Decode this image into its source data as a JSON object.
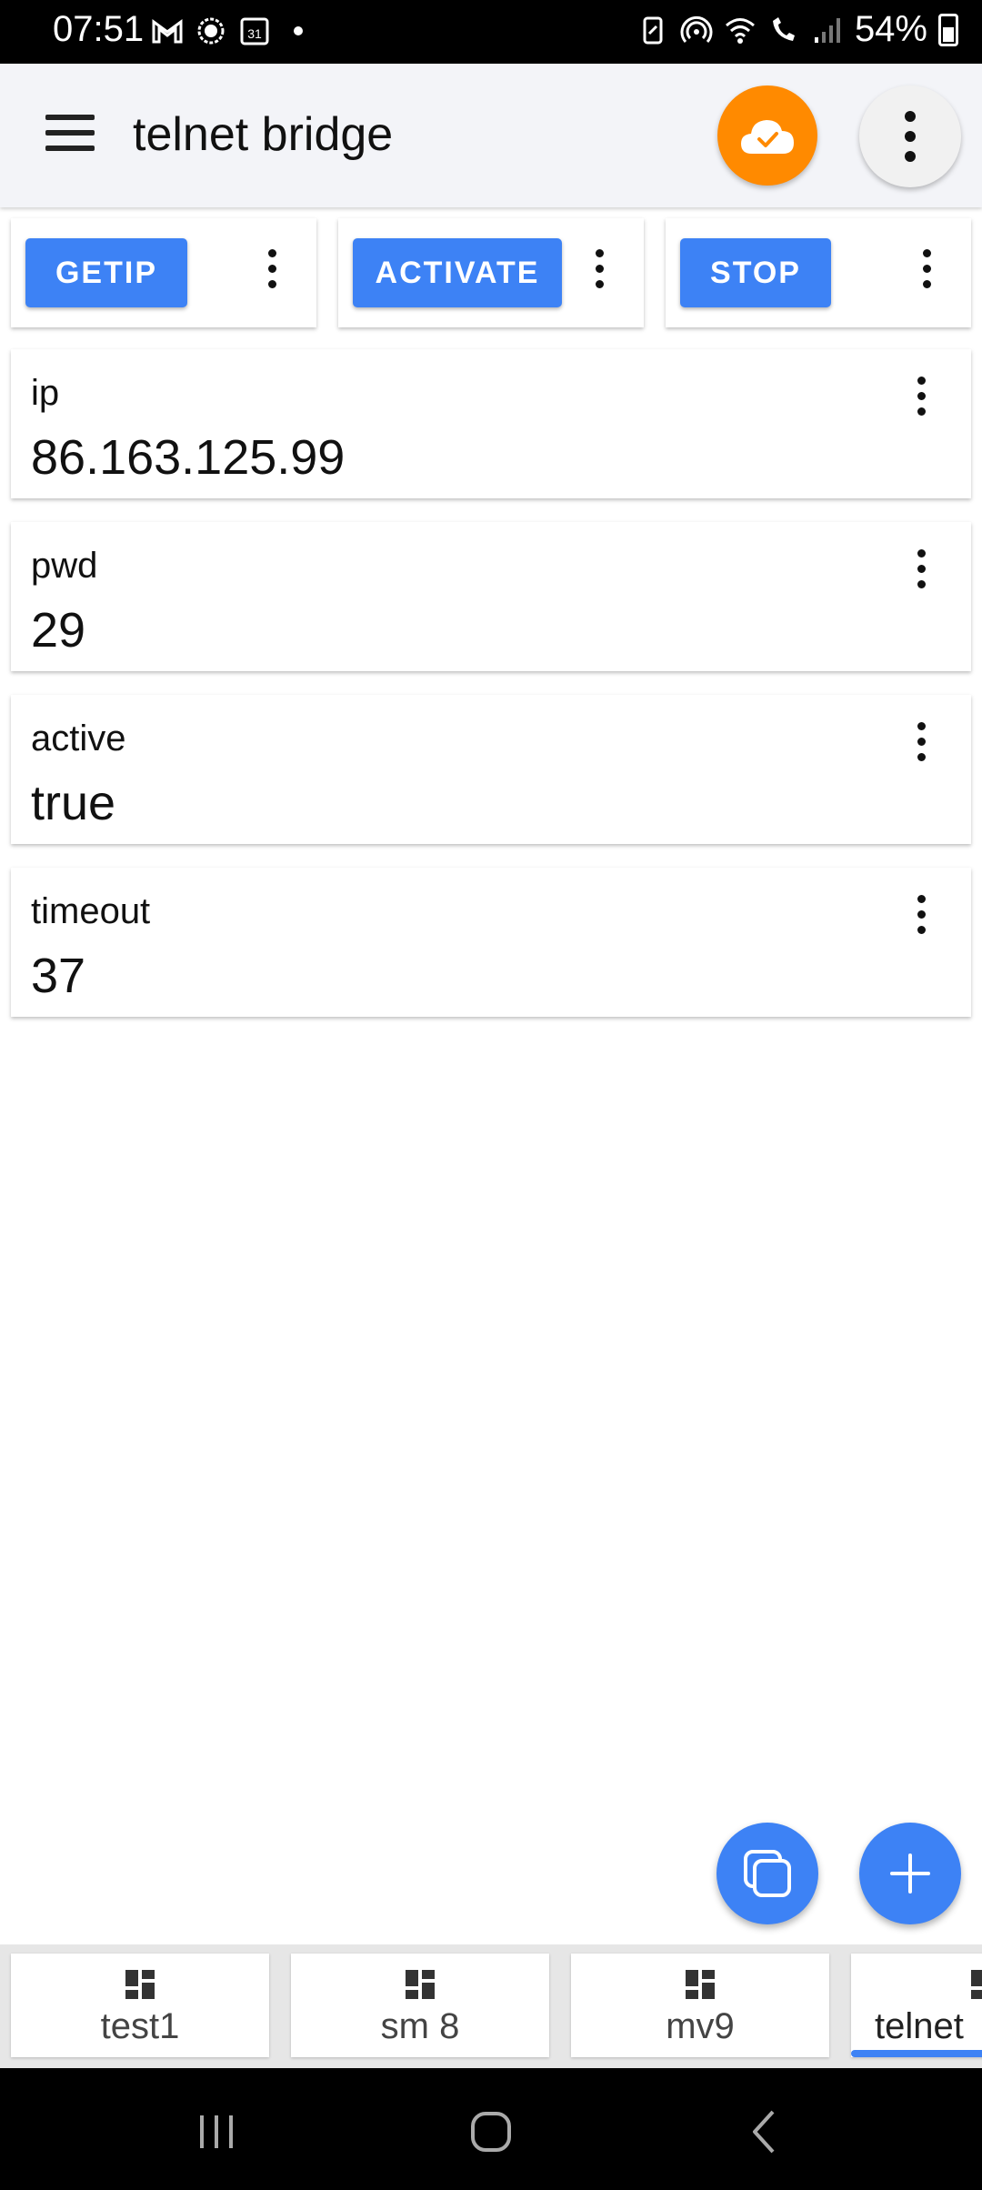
{
  "status_bar": {
    "time": "07:51",
    "battery": "54%",
    "left_icons": [
      "gmail-icon",
      "signal-messenger-icon",
      "calendar-icon",
      "dot-icon"
    ],
    "right_icons": [
      "battery-saver-icon",
      "hotspot-icon",
      "wifi-icon",
      "wifi-call-icon",
      "cell-signal-icon"
    ]
  },
  "app_bar": {
    "title": "telnet bridge",
    "cloud_status_color": "#ff8a00"
  },
  "buttons": [
    {
      "label": "GETIP"
    },
    {
      "label": "ACTIVATE"
    },
    {
      "label": "STOP"
    }
  ],
  "values": [
    {
      "label": "ip",
      "value": "86.163.125.99"
    },
    {
      "label": "pwd",
      "value": "29"
    },
    {
      "label": "active",
      "value": "true"
    },
    {
      "label": "timeout",
      "value": "37"
    }
  ],
  "tabs": [
    {
      "label": "test1"
    },
    {
      "label": "sm 8"
    },
    {
      "label": "mv9"
    },
    {
      "label": "telnet",
      "active": true
    }
  ],
  "colors": {
    "accent": "#3d82f5",
    "appbar_bg": "#f3f4f8"
  }
}
